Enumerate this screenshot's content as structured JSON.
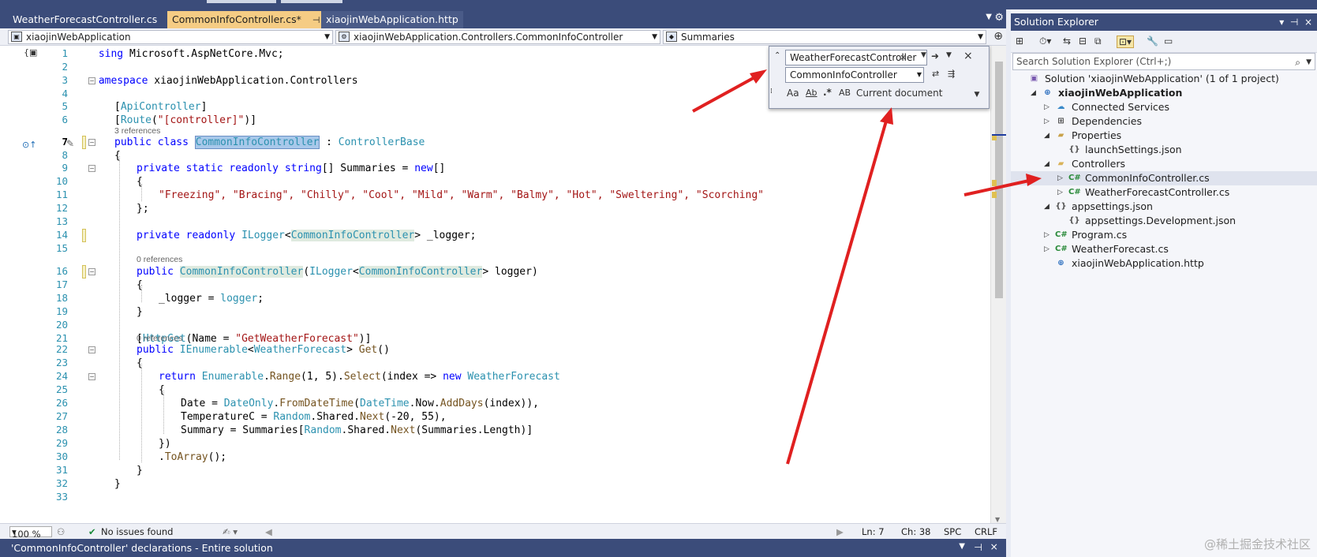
{
  "editor": {
    "tabs": [
      {
        "label": "WeatherForecastController.cs"
      },
      {
        "label": "CommonInfoController.cs*",
        "pin": "⊣",
        "close": "×"
      },
      {
        "label": "xiaojinWebApplication.http"
      }
    ],
    "nav": {
      "project": "xiaojinWebApplication",
      "type": "xiaojinWebApplication.Controllers.CommonInfoController",
      "member": "Summaries"
    },
    "line_numbers": [
      "1",
      "2",
      "3",
      "4",
      "5",
      "6",
      "7",
      "8",
      "9",
      "10",
      "11",
      "12",
      "13",
      "14",
      "15",
      "16",
      "17",
      "18",
      "19",
      "20",
      "21",
      "22",
      "23",
      "24",
      "25",
      "26",
      "27",
      "28",
      "29",
      "30",
      "31",
      "32",
      "33"
    ],
    "current_line": "7",
    "code": {
      "l1_kw": "using",
      "l1_rest": " Microsoft.AspNetCore.Mvc;",
      "l3_kw": "namespace",
      "l3_rest": " xiaojinWebApplication.Controllers",
      "l4": "{",
      "l5_a": "[",
      "l5_attr": "ApiController",
      "l5_b": "]",
      "l6_a": "[",
      "l6_attr": "Route",
      "l6_b": "(",
      "l6_str": "\"[controller]\"",
      "l6_c": ")]",
      "refs_3": "3 references",
      "l7_kw": "public class ",
      "l7_name": "CommonInfoController",
      "l7_colon": " : ",
      "l7_base": "ControllerBase",
      "l8": "{",
      "l9_kw": "private static readonly ",
      "l9_type": "string",
      "l9_rest": "[] Summaries = ",
      "l9_new": "new",
      "l9_end": "[]",
      "l10": "{",
      "l11_str": "\"Freezing\", \"Bracing\", \"Chilly\", \"Cool\", \"Mild\", \"Warm\", \"Balmy\", \"Hot\", \"Sweltering\", \"Scorching\"",
      "l12": "};",
      "l14_kw": "private readonly ",
      "l14_type": "ILogger",
      "l14_lt": "<",
      "l14_gen": "CommonInfoController",
      "l14_rest": "> _logger;",
      "refs_0a": "0 references",
      "l16_kw": "public ",
      "l16_name": "CommonInfoController",
      "l16_p": "(",
      "l16_type": "ILogger",
      "l16_lt": "<",
      "l16_gen": "CommonInfoController",
      "l16_rest": "> logger)",
      "l17": "{",
      "l18_a": "_logger = ",
      "l18_b": "logger",
      "l18_c": ";",
      "l19": "}",
      "l21_a": "[",
      "l21_attr": "HttpGet",
      "l21_b": "(Name = ",
      "l21_str": "\"GetWeatherForecast\"",
      "l21_c": ")]",
      "refs_0b": "0 references",
      "l22_kw": "public ",
      "l22_type": "IEnumerable",
      "l22_lt": "<",
      "l22_gen": "WeatherForecast",
      "l22_gt": "> ",
      "l22_m": "Get",
      "l22_end": "()",
      "l23": "{",
      "l24_kw": "return ",
      "l24_t": "Enumerable",
      "l24_d": ".",
      "l24_m": "Range",
      "l24_a": "(1, 5).",
      "l24_m2": "Select",
      "l24_b": "(index => ",
      "l24_new": "new ",
      "l24_t2": "WeatherForecast",
      "l25": "{",
      "l26_a": "Date = ",
      "l26_t": "DateOnly",
      "l26_d": ".",
      "l26_m": "FromDateTime",
      "l26_p": "(",
      "l26_t2": "DateTime",
      "l26_r": ".Now.",
      "l26_m2": "AddDays",
      "l26_e": "(index)),",
      "l27_a": "TemperatureC = ",
      "l27_t": "Random",
      "l27_r": ".Shared.",
      "l27_m": "Next",
      "l27_e": "(-20, 55),",
      "l28_a": "Summary = Summaries[",
      "l28_t": "Random",
      "l28_r": ".Shared.",
      "l28_m": "Next",
      "l28_e": "(Summaries.Length)]",
      "l29": "})",
      "l30_d": ".",
      "l30_m": "ToArray",
      "l30_e": "();",
      "l31": "}",
      "l32": "}",
      "l33": "}"
    },
    "find": {
      "search_text": "WeatherForecastController",
      "replace_text": "CommonInfoController",
      "opt_case": "Aa",
      "opt_word": "Ab",
      "opt_regex": ".*",
      "opt_preserve": "AB",
      "scope": "Current document"
    },
    "status": {
      "zoom": "100 %",
      "issues": "No issues found",
      "line": "Ln: 7",
      "col": "Ch: 38",
      "spc": "SPC",
      "eol": "CRLF"
    }
  },
  "bottom_panel": {
    "title": "'CommonInfoController' declarations - Entire solution"
  },
  "solution_explorer": {
    "title": "Solution Explorer",
    "search_placeholder": "Search Solution Explorer (Ctrl+;)",
    "items": [
      {
        "label": "Solution 'xiaojinWebApplication' (1 of 1 project)",
        "icon": "solution-icon"
      },
      {
        "label": "xiaojinWebApplication",
        "icon": "web-project-icon"
      },
      {
        "label": "Connected Services",
        "icon": "connected-services-icon"
      },
      {
        "label": "Dependencies",
        "icon": "dependencies-icon"
      },
      {
        "label": "Properties",
        "icon": "properties-folder-icon"
      },
      {
        "label": "launchSettings.json",
        "icon": "json-file-icon"
      },
      {
        "label": "Controllers",
        "icon": "folder-icon"
      },
      {
        "label": "CommonInfoController.cs",
        "icon": "csharp-file-icon"
      },
      {
        "label": "WeatherForecastController.cs",
        "icon": "csharp-file-icon"
      },
      {
        "label": "appsettings.json",
        "icon": "json-file-icon"
      },
      {
        "label": "appsettings.Development.json",
        "icon": "json-file-icon"
      },
      {
        "label": "Program.cs",
        "icon": "csharp-file-icon"
      },
      {
        "label": "WeatherForecast.cs",
        "icon": "csharp-file-icon"
      },
      {
        "label": "xiaojinWebApplication.http",
        "icon": "http-file-icon"
      }
    ]
  },
  "watermark": "@稀土掘金技术社区",
  "colors": {
    "title_bar": "#3b4c7a",
    "active_tab": "#f5cc84",
    "keyword": "#0000ff",
    "type": "#2b91af",
    "string": "#a31515",
    "annotation_arrow": "#e02020"
  }
}
